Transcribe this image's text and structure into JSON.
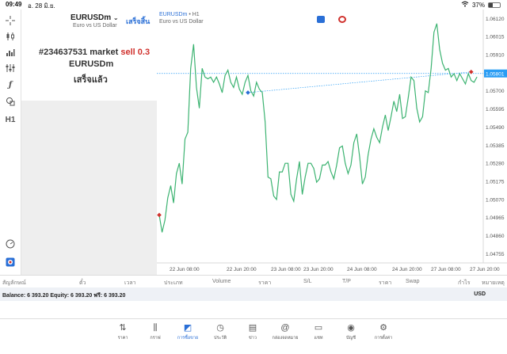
{
  "status_bar": {
    "time": "09:49",
    "date": "อ. 28 มิ.ย.",
    "battery": "37%",
    "battery_level": 0.37
  },
  "trade_panel": {
    "symbol": "EURUSDm",
    "symbol_description": "Euro vs US Dollar",
    "done_label": "เสร็จสิ้น",
    "order_number": "#234637531 market",
    "order_side_volume": "sell 0.3",
    "order_symbol": "EURUSDm",
    "order_status": "เสร็จแล้ว"
  },
  "left_toolbar": {
    "timeframe": "H1",
    "icons": [
      "crosshair-icon",
      "candlestick-icon",
      "bar-chart-icon",
      "sliders-icon",
      "function-icon",
      "shapes-icon",
      "h1-timeframe",
      "gauge-icon",
      "logo-icon"
    ]
  },
  "chart": {
    "title": "EURUSDm",
    "timeframe": "• H1",
    "subtitle": "Euro vs US Dollar",
    "current_price": "1.05801",
    "line_color": "#3cb371",
    "price_line_color": "#2a9df4"
  },
  "chart_data": {
    "type": "line",
    "symbol": "EURUSDm",
    "timeframe": "H1",
    "y_ticks": [
      "1.06120",
      "1.06015",
      "1.05910",
      "1.05805",
      "1.05700",
      "1.05595",
      "1.05490",
      "1.05385",
      "1.05280",
      "1.05175",
      "1.05070",
      "1.04965",
      "1.04860",
      "1.04755"
    ],
    "ylim": [
      1.04702,
      1.06172
    ],
    "x_ticks": [
      "22 Jun 08:00",
      "22 Jun 20:00",
      "23 Jun 08:00",
      "23 Jun 20:00",
      "24 Jun 08:00",
      "24 Jun 20:00",
      "27 Jun 08:00",
      "27 Jun 20:00"
    ],
    "series": [
      {
        "values": [
          1.0498,
          1.0488,
          1.0495,
          1.0508,
          1.0515,
          1.0505,
          1.0522,
          1.0528,
          1.0516,
          1.0542,
          1.0546,
          1.0583,
          1.0597,
          1.0572,
          1.056,
          1.0583,
          1.0578,
          1.0577,
          1.0578,
          1.0575,
          1.0578,
          1.0574,
          1.0569,
          1.0579,
          1.0582,
          1.0575,
          1.0572,
          1.0578,
          1.0571,
          1.0568,
          1.0575,
          1.0579,
          1.057,
          1.0567,
          1.0575,
          1.0571,
          1.0569,
          1.0552,
          1.052,
          1.0519,
          1.0509,
          1.0507,
          1.0523,
          1.0523,
          1.0528,
          1.0528,
          1.051,
          1.0506,
          1.0519,
          1.0529,
          1.051,
          1.052,
          1.0528,
          1.0528,
          1.0525,
          1.0517,
          1.0519,
          1.0527,
          1.0527,
          1.0529,
          1.0523,
          1.0519,
          1.0527,
          1.0537,
          1.0538,
          1.0528,
          1.0522,
          1.0527,
          1.054,
          1.0545,
          1.0532,
          1.0516,
          1.052,
          1.0533,
          1.0542,
          1.0548,
          1.0543,
          1.054,
          1.0549,
          1.0556,
          1.0547,
          1.0555,
          1.0564,
          1.0558,
          1.0568,
          1.0554,
          1.0555,
          1.0566,
          1.0578,
          1.0576,
          1.056,
          1.0552,
          1.0555,
          1.057,
          1.0569,
          1.0583,
          1.0604,
          1.0609,
          1.0594,
          1.0586,
          1.0582,
          1.0583,
          1.0578,
          1.058,
          1.0576,
          1.058,
          1.0577,
          1.0574,
          1.058,
          1.0576,
          1.0575,
          1.0578
        ]
      }
    ],
    "current_price": 1.05801,
    "order_markers": [
      {
        "kind": "entry",
        "index": 0,
        "price": 1.0498,
        "color": "#d0312d"
      },
      {
        "kind": "order",
        "index": 31,
        "price": 1.0569,
        "color": "#2a6fd6"
      },
      {
        "kind": "exit",
        "index": 109,
        "price": 1.0581,
        "color": "#d0312d"
      }
    ]
  },
  "table": {
    "columns": [
      "สัญลักษณ์",
      "ตั๋ว",
      "เวลา",
      "ประเภท",
      "Volume",
      "ราคา",
      "S/L",
      "T/P",
      "ราคา",
      "Swap",
      "กำไร",
      "หมายเหตุ"
    ]
  },
  "balance": {
    "text": "Balance: 6 393.20 Equity: 6 393.20 ฟรี: 6 393.20",
    "currency": "USD"
  },
  "bottom_nav": [
    {
      "label": "ราคา",
      "icon": "arrows-updown-icon",
      "active": false
    },
    {
      "label": "กราฟ",
      "icon": "candlestick-icon",
      "active": false
    },
    {
      "label": "การซื้อขาย",
      "icon": "trade-chart-icon",
      "active": true
    },
    {
      "label": "ประวัติ",
      "icon": "history-icon",
      "active": false
    },
    {
      "label": "ข่าว",
      "icon": "news-icon",
      "active": false
    },
    {
      "label": "กล่องจดหมาย",
      "icon": "at-icon",
      "active": false
    },
    {
      "label": "แชท",
      "icon": "chat-icon",
      "active": false
    },
    {
      "label": "บัญชี",
      "icon": "account-icon",
      "active": false
    },
    {
      "label": "การตั้งค่า",
      "icon": "gear-icon",
      "active": false
    }
  ]
}
